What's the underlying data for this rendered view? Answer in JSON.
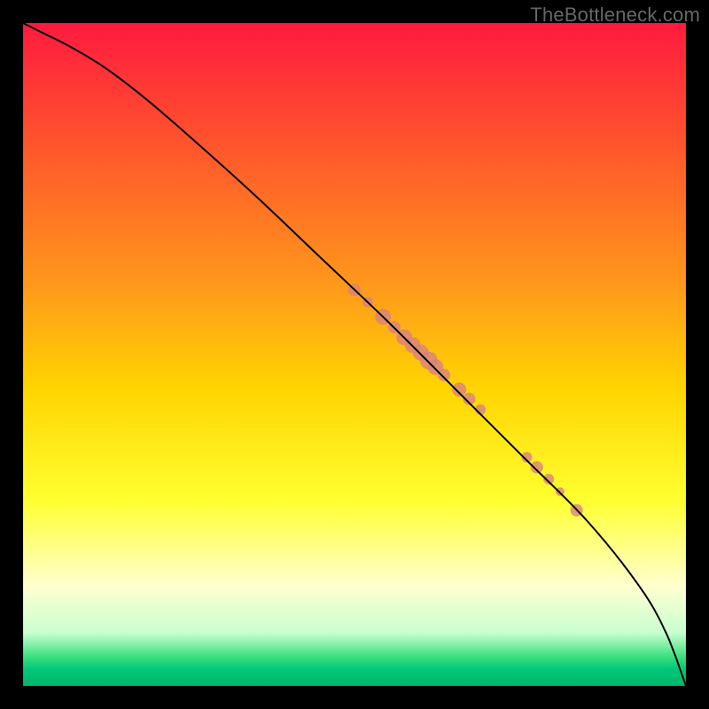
{
  "watermark": "TheBottleneck.com",
  "colors": {
    "frame": "#000000",
    "marker": "#d98080",
    "gradient_stops": [
      {
        "offset": 0.0,
        "color": "#ff1a3f"
      },
      {
        "offset": 0.2,
        "color": "#ff5a2a"
      },
      {
        "offset": 0.4,
        "color": "#ff9a1a"
      },
      {
        "offset": 0.55,
        "color": "#ffd400"
      },
      {
        "offset": 0.72,
        "color": "#ffff30"
      },
      {
        "offset": 0.85,
        "color": "#ffffd0"
      },
      {
        "offset": 0.92,
        "color": "#c8ffd0"
      },
      {
        "offset": 0.955,
        "color": "#40e080"
      },
      {
        "offset": 0.975,
        "color": "#00c878"
      },
      {
        "offset": 1.0,
        "color": "#00b46a"
      }
    ]
  },
  "chart_data": {
    "type": "line",
    "title": "",
    "xlabel": "",
    "ylabel": "",
    "xlim": [
      0,
      1
    ],
    "ylim": [
      0,
      1
    ],
    "grid": false,
    "legend": false,
    "series": [
      {
        "name": "curve",
        "x": [
          0.0,
          0.03,
          0.07,
          0.12,
          0.18,
          0.25,
          0.35,
          0.45,
          0.55,
          0.65,
          0.75,
          0.85,
          0.93,
          0.97,
          1.0
        ],
        "y": [
          1.0,
          0.985,
          0.965,
          0.935,
          0.89,
          0.83,
          0.74,
          0.645,
          0.55,
          0.45,
          0.35,
          0.25,
          0.15,
          0.08,
          0.0
        ]
      }
    ],
    "markers": [
      {
        "x": 0.5,
        "y": 0.597,
        "r": 7
      },
      {
        "x": 0.52,
        "y": 0.579,
        "r": 6
      },
      {
        "x": 0.543,
        "y": 0.557,
        "r": 9
      },
      {
        "x": 0.56,
        "y": 0.541,
        "r": 7
      },
      {
        "x": 0.575,
        "y": 0.526,
        "r": 9
      },
      {
        "x": 0.588,
        "y": 0.514,
        "r": 9
      },
      {
        "x": 0.6,
        "y": 0.503,
        "r": 9
      },
      {
        "x": 0.612,
        "y": 0.491,
        "r": 10
      },
      {
        "x": 0.622,
        "y": 0.481,
        "r": 9
      },
      {
        "x": 0.635,
        "y": 0.469,
        "r": 7
      },
      {
        "x": 0.658,
        "y": 0.447,
        "r": 8
      },
      {
        "x": 0.673,
        "y": 0.433,
        "r": 7
      },
      {
        "x": 0.69,
        "y": 0.417,
        "r": 6
      },
      {
        "x": 0.76,
        "y": 0.345,
        "r": 6
      },
      {
        "x": 0.775,
        "y": 0.33,
        "r": 7
      },
      {
        "x": 0.793,
        "y": 0.312,
        "r": 6
      },
      {
        "x": 0.81,
        "y": 0.293,
        "r": 5
      },
      {
        "x": 0.835,
        "y": 0.265,
        "r": 7
      }
    ]
  }
}
